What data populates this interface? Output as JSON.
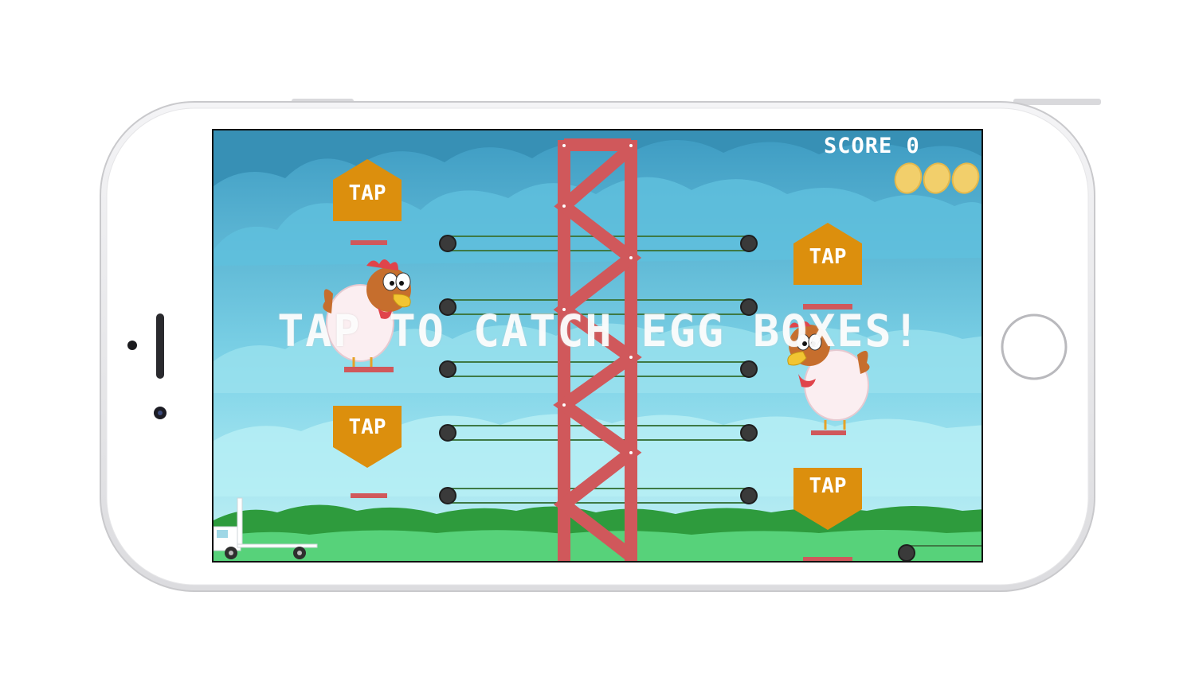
{
  "hud": {
    "score_label": "SCORE 0",
    "eggs_remaining": 3
  },
  "buttons": {
    "tap_top_left": "TAP",
    "tap_bottom_left": "TAP",
    "tap_top_right": "TAP",
    "tap_bottom_right": "TAP"
  },
  "banner": "TAP TO CATCH EGG BOXES!",
  "colors": {
    "sky_top": "#3f9fc4",
    "sky_bottom": "#c8f4f7",
    "tower": "#d0585b",
    "tap_button": "#dc8f0d",
    "grass_dark": "#2f9d3d",
    "grass_light": "#58d27a",
    "perch": "#d0585b"
  }
}
